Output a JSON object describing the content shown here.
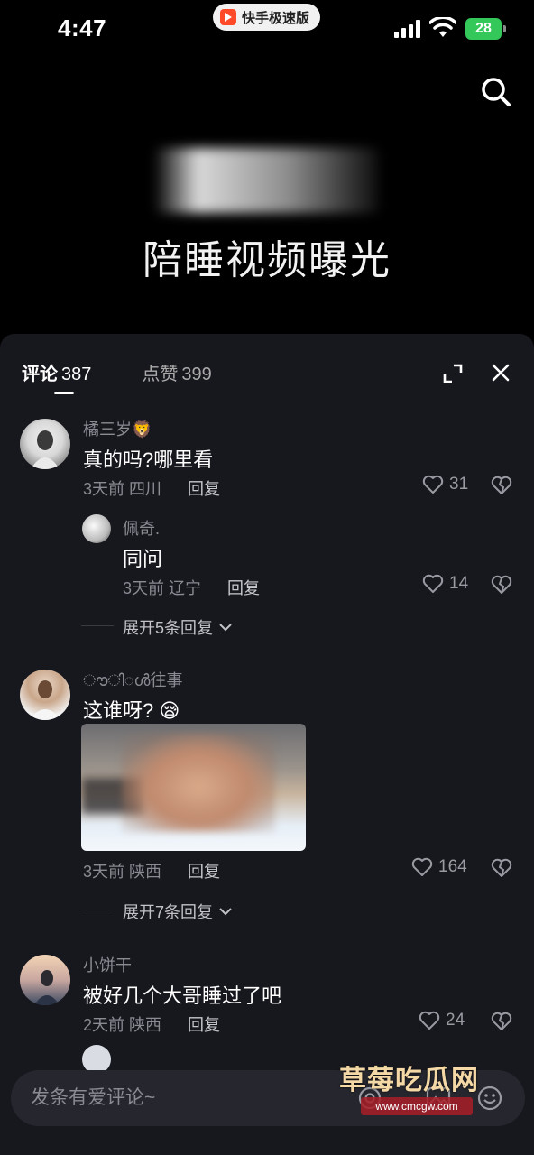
{
  "status_bar": {
    "time": "4:47",
    "app_badge": "快手极速版",
    "battery": "28"
  },
  "video": {
    "caption": "陪睡视频曝光",
    "colors": {
      "background": "#000000"
    }
  },
  "panel": {
    "tabs": [
      {
        "label": "评论",
        "count": "387"
      },
      {
        "label": "点赞",
        "count": "399"
      }
    ],
    "reply_label": "回复"
  },
  "comments": [
    {
      "username": "橘三岁",
      "username_emoji": "🦁",
      "text": "真的吗?哪里看",
      "time": "3天前",
      "location": "四川",
      "likes": "31"
    },
    {
      "username": "佩奇.",
      "text": "同问",
      "time": "3天前",
      "location": "辽宁",
      "likes": "14"
    },
    {
      "expand": "展开5条回复"
    },
    {
      "username": "ൗ◌ി◌ൾ往事",
      "text": "这谁呀?",
      "text_emoji": "😪",
      "time": "3天前",
      "location": "陕西",
      "likes": "164"
    },
    {
      "expand": "展开7条回复"
    },
    {
      "username": "小饼干",
      "text": "被好几个大哥睡过了吧",
      "time": "2天前",
      "location": "陕西",
      "likes": "24"
    }
  ],
  "input": {
    "placeholder": "发条有爱评论~"
  },
  "watermark": {
    "title": "草莓吃瓜网",
    "url": "www.cmcgw.com"
  }
}
